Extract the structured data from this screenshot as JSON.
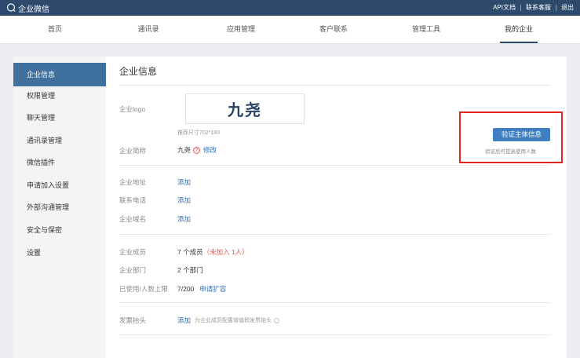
{
  "topbar": {
    "brand": "企业微信",
    "links": [
      "API文档",
      "联系客服",
      "退出"
    ]
  },
  "nav": {
    "items": [
      "首页",
      "通讯录",
      "应用管理",
      "客户联系",
      "管理工具",
      "我的企业"
    ],
    "active": "我的企业"
  },
  "sidebar": {
    "items": [
      "企业信息",
      "权限管理",
      "聊天管理",
      "通讯录管理",
      "微信插件",
      "申请加入设置",
      "外部沟通管理",
      "安全与保密",
      "设置"
    ]
  },
  "main": {
    "title": "企业信息",
    "logo": {
      "label": "企业logo",
      "text": "九尧",
      "hint": "推荐尺寸702*180"
    },
    "short_name": {
      "label": "企业简称",
      "value": "九尧",
      "help": "?",
      "edit": "修改"
    },
    "address": {
      "label": "企业地址",
      "action": "添加"
    },
    "phone": {
      "label": "联系电话",
      "action": "添加"
    },
    "domain": {
      "label": "企业域名",
      "action": "添加"
    },
    "members": {
      "label": "企业成员",
      "value": "7 个成员",
      "pending": "（未加入 1人）"
    },
    "departments": {
      "label": "企业部门",
      "value": "2 个部门"
    },
    "capacity": {
      "label": "已使用/人数上限",
      "value": "7/200",
      "action": "申请扩容"
    },
    "invoice": {
      "label": "发票抬头",
      "action": "添加",
      "hint": "为企业成员配置增值税发票抬头"
    }
  },
  "verify": {
    "button": "验证主体信息",
    "hint": "验证后可提高使用人数",
    "highlight_color": "#e3261f"
  },
  "colors": {
    "topbar": "#2d4a6d",
    "sidebar_active": "#40709d",
    "link": "#2a6fb8",
    "button": "#3f7fc1",
    "warning": "#e8534f"
  }
}
